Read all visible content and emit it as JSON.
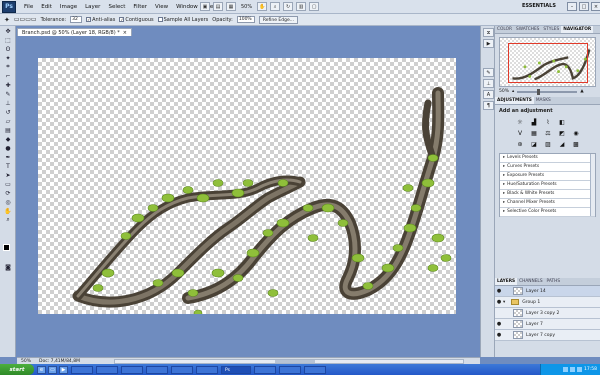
{
  "menubar": {
    "logo": "Ps",
    "items": [
      "File",
      "Edit",
      "Image",
      "Layer",
      "Select",
      "Filter",
      "View",
      "Window",
      "Help"
    ],
    "zoom": "50%",
    "workspace": "ESSENTIALS",
    "window_controls": [
      "–",
      "□",
      "×"
    ]
  },
  "options": {
    "tolerance_label": "Tolerance:",
    "tolerance_value": "32",
    "antialias_label": "Anti-alias",
    "contiguous_label": "Contiguous",
    "sample_all_label": "Sample All Layers",
    "opacity_label": "Opacity:",
    "opacity_value": "100%",
    "refine_label": "Refine Edge..."
  },
  "document": {
    "tab_title": "Branch.psd @ 50% (Layer 18, RGB/8) *",
    "tab_close": "×"
  },
  "status": {
    "zoom": "50%",
    "doc_info": "Doc: 7,41M/84,8M"
  },
  "navigator": {
    "tabs": [
      "COLOR",
      "SWATCHES",
      "STYLES",
      "NAVIGATOR"
    ],
    "active_tab": "NAVIGATOR",
    "zoom": "50%"
  },
  "adjustments": {
    "tabs": [
      "ADJUSTMENTS",
      "MASKS"
    ],
    "title": "Add an adjustment",
    "presets": [
      "Levels Presets",
      "Curves Presets",
      "Exposure Presets",
      "Hue/Saturation Presets",
      "Black & White Presets",
      "Channel Mixer Presets",
      "Selective Color Presets"
    ]
  },
  "layers": {
    "tabs": [
      "LAYERS",
      "CHANNELS",
      "PATHS"
    ],
    "items": [
      {
        "name": "Layer 14",
        "type": "layer"
      },
      {
        "name": "Group 1",
        "type": "group"
      },
      {
        "name": "Layer 3 copy 2",
        "type": "layer"
      },
      {
        "name": "Layer 7",
        "type": "layer"
      },
      {
        "name": "Layer 7 copy",
        "type": "layer"
      }
    ],
    "footer_icons": [
      "link-icon",
      "fx-icon",
      "mask-icon",
      "adjustment-icon",
      "folder-icon",
      "new-layer-icon",
      "trash-icon"
    ]
  },
  "taskbar": {
    "start": "start",
    "tasks": [
      "",
      "",
      "",
      "",
      "",
      "",
      "Ps",
      "",
      "",
      ""
    ],
    "clock": "17:58"
  },
  "colors": {
    "canvas_background": "#6f8cbf",
    "foreground": "#000000",
    "background": "#f0c64a",
    "navigator_frame": "#e23a2a"
  }
}
